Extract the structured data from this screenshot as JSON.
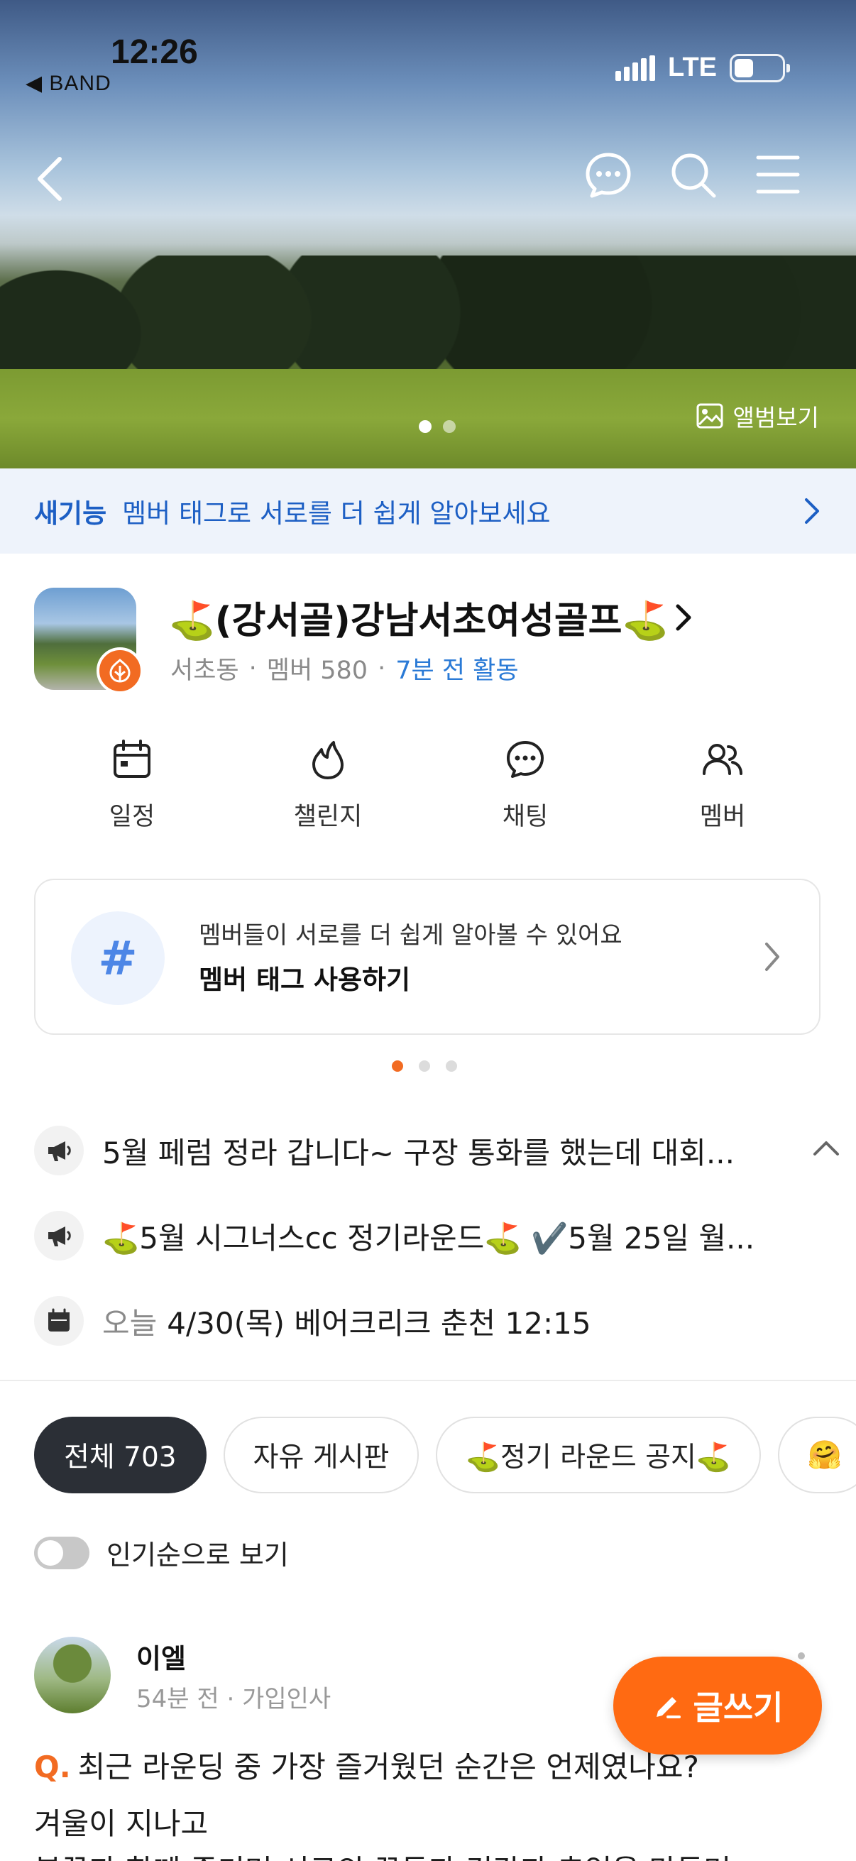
{
  "status_bar": {
    "time": "12:26",
    "back_app": "◀ BAND",
    "network": "LTE"
  },
  "hero": {
    "album_label": "앨범보기",
    "slides": 2,
    "active_slide": 1
  },
  "feature_banner": {
    "tag": "새기능",
    "text": "멤버 태그로 서로를 더 쉽게 알아보세요"
  },
  "band": {
    "title": "⛳(강서골)강남서초여성골프⛳",
    "location": "서초동",
    "members": "멤버 580",
    "activity": "7분 전 활동"
  },
  "quick_menu": [
    {
      "label": "일정",
      "icon": "calendar-icon"
    },
    {
      "label": "챌린지",
      "icon": "flame-icon"
    },
    {
      "label": "채팅",
      "icon": "chat-icon"
    },
    {
      "label": "멤버",
      "icon": "members-icon"
    }
  ],
  "tag_card": {
    "line1": "멤버들이 서로를 더 쉽게 알아볼 수 있어요",
    "line2": "멤버 태그 사용하기",
    "hash": "#"
  },
  "notices": [
    {
      "text": "5월 페럼 정라 갑니다~  구장 통화를 했는데 대회..."
    },
    {
      "text": "⛳5월 시그너스cc 정기라운드⛳ ✔️5월 25일 월..."
    }
  ],
  "schedule": {
    "today": "오늘",
    "text": "4/30(목) 베어크리크 춘천 12:15"
  },
  "chips": [
    {
      "label": "전체 703",
      "active": true
    },
    {
      "label": "자유 게시판",
      "active": false
    },
    {
      "label": "⛳정기 라운드 공지⛳",
      "active": false
    },
    {
      "label": "🤗",
      "active": false
    }
  ],
  "popular_toggle": {
    "label": "인기순으로 보기",
    "on": false
  },
  "post": {
    "author": "이엘",
    "meta": "54분 전 · 가입인사",
    "q_mark": "Q.",
    "question": "최근 라운딩 중 가장 즐거웠던 순간은 언제였나요?",
    "line2": "겨울이 지나고",
    "line3": "봄꽃과 함께 즐기며 서로의 꿈들과 건강과 추억을 만들며"
  },
  "write_button": "글쓰기",
  "colors": {
    "accent": "#ff6a12",
    "link_blue": "#1d5fc4",
    "chip_active": "#2b2f36"
  }
}
